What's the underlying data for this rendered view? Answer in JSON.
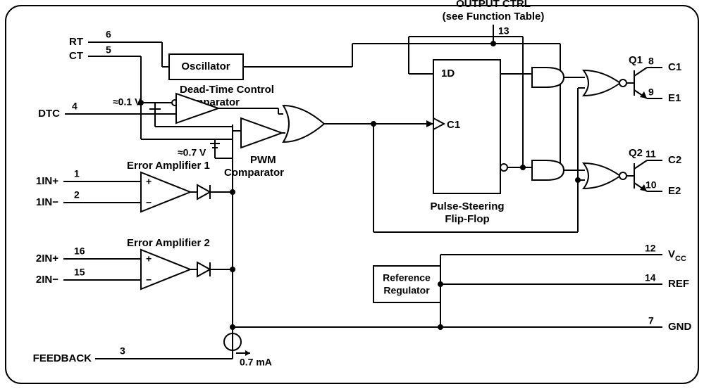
{
  "title1": "OUTPUT CTRL",
  "title2": "(see Function Table)",
  "pins": {
    "rt": {
      "name": "RT",
      "num": "6"
    },
    "ct": {
      "name": "CT",
      "num": "5"
    },
    "dtc": {
      "name": "DTC",
      "num": "4"
    },
    "in1p": {
      "name": "1IN+",
      "num": "1"
    },
    "in1n": {
      "name": "1IN−",
      "num": "2"
    },
    "in2p": {
      "name": "2IN+",
      "num": "16"
    },
    "in2n": {
      "name": "2IN−",
      "num": "15"
    },
    "fb": {
      "name": "FEEDBACK",
      "num": "3"
    },
    "oc": {
      "num": "13"
    },
    "q1": {
      "name": "Q1"
    },
    "c1": {
      "name": "C1",
      "num": "8"
    },
    "e1": {
      "name": "E1",
      "num": "9"
    },
    "q2": {
      "name": "Q2"
    },
    "c2": {
      "name": "C2",
      "num": "11"
    },
    "e2": {
      "name": "E2",
      "num": "10"
    },
    "vcc": {
      "name": "V",
      "sub": "CC",
      "num": "12"
    },
    "ref": {
      "name": "REF",
      "num": "14"
    },
    "gnd": {
      "name": "GND",
      "num": "7"
    }
  },
  "blocks": {
    "osc": "Oscillator",
    "dtc1": "Dead-Time Control",
    "dtc2": "Comparator",
    "pwm1": "PWM",
    "pwm2": "Comparator",
    "ea1": "Error Amplifier 1",
    "ea2": "Error Amplifier 2",
    "psff1": "Pulse-Steering",
    "psff2": "Flip-Flop",
    "rr1": "Reference",
    "rr2": "Regulator",
    "ff_d": "1D",
    "ff_c": "C1"
  },
  "values": {
    "v01": "≈0.1 V",
    "v07": "≈0.7 V",
    "i07": "0.7 mA"
  },
  "signs": {
    "plus": "+",
    "minus": "−"
  }
}
